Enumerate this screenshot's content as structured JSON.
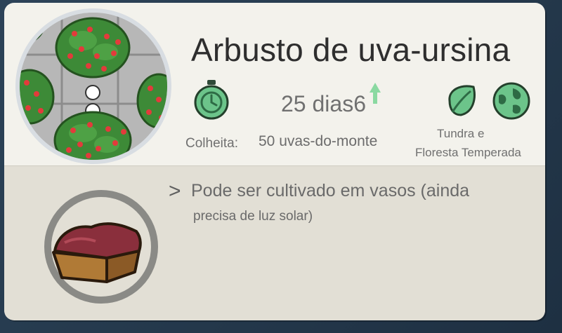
{
  "card": {
    "title": "Arbusto de uva-ursina",
    "growth_time": "25 dias6",
    "harvest_label": "Colheita:",
    "harvest_value": "50 uvas-do-monte",
    "biome_line1": "Tundra e",
    "biome_line2": "Floresta Temperada",
    "note_arrow": ">",
    "note_line1": "Pode ser cultivado em vasos (ainda",
    "note_line2": "precisa de luz solar)"
  },
  "icons": {
    "growth": "stopwatch-icon",
    "biome_leaf": "leaf-icon",
    "biome_world": "globe-icon",
    "pot": "planter-pot-icon",
    "plant": "bearberry-bush-portrait"
  },
  "colors": {
    "card_bg": "#f3f2ec",
    "card_lower_bg": "#e2dfd5",
    "icon_green": "#6cc48a",
    "berry_red": "#e23b3b",
    "bush_green": "#3d8a37"
  }
}
